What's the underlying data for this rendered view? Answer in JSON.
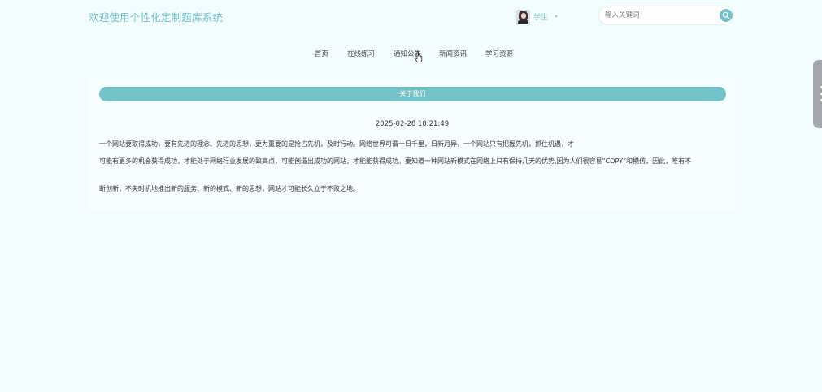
{
  "header": {
    "site_title": "欢迎使用个性化定制题库系统",
    "user_name": "学生",
    "search_placeholder": "输入关键词"
  },
  "nav": {
    "items": [
      {
        "label": "首页"
      },
      {
        "label": "在线练习"
      },
      {
        "label": "通知公告"
      },
      {
        "label": "新闻资讯"
      },
      {
        "label": "学习资源"
      }
    ]
  },
  "article": {
    "title": "关于我们",
    "date": "2025-02-28 18:21:49",
    "paragraphs": [
      "一个网站要取得成功，要有先进的理念、先进的思想，更为重要的是抢占先机，及时行动。网络世界可谓一日千里，日新月异，一个网站只有把握先机，抓住机遇，才",
      "可能有更多的机会获得成功，才能处于网络行业发展的致高点，可能创造出成功的网站，才能能获得成功。要知道一种网站新模式在网络上只有保持几天的优势,因为人们很容易“COPY”和模仿，因此，唯有不",
      "断创新，不失时机地推出新的服务、新的模式、新的思想，网站才可能长久立于不败之地。"
    ]
  },
  "colors": {
    "accent": "#72c2c7",
    "background": "#f3fcfd",
    "card": "#f7fdfe",
    "side_tab": "#a4a7a8"
  },
  "icons": {
    "search": "search-icon",
    "user_caret": "chevron-down-icon",
    "cursor": "hand-pointer-icon"
  }
}
